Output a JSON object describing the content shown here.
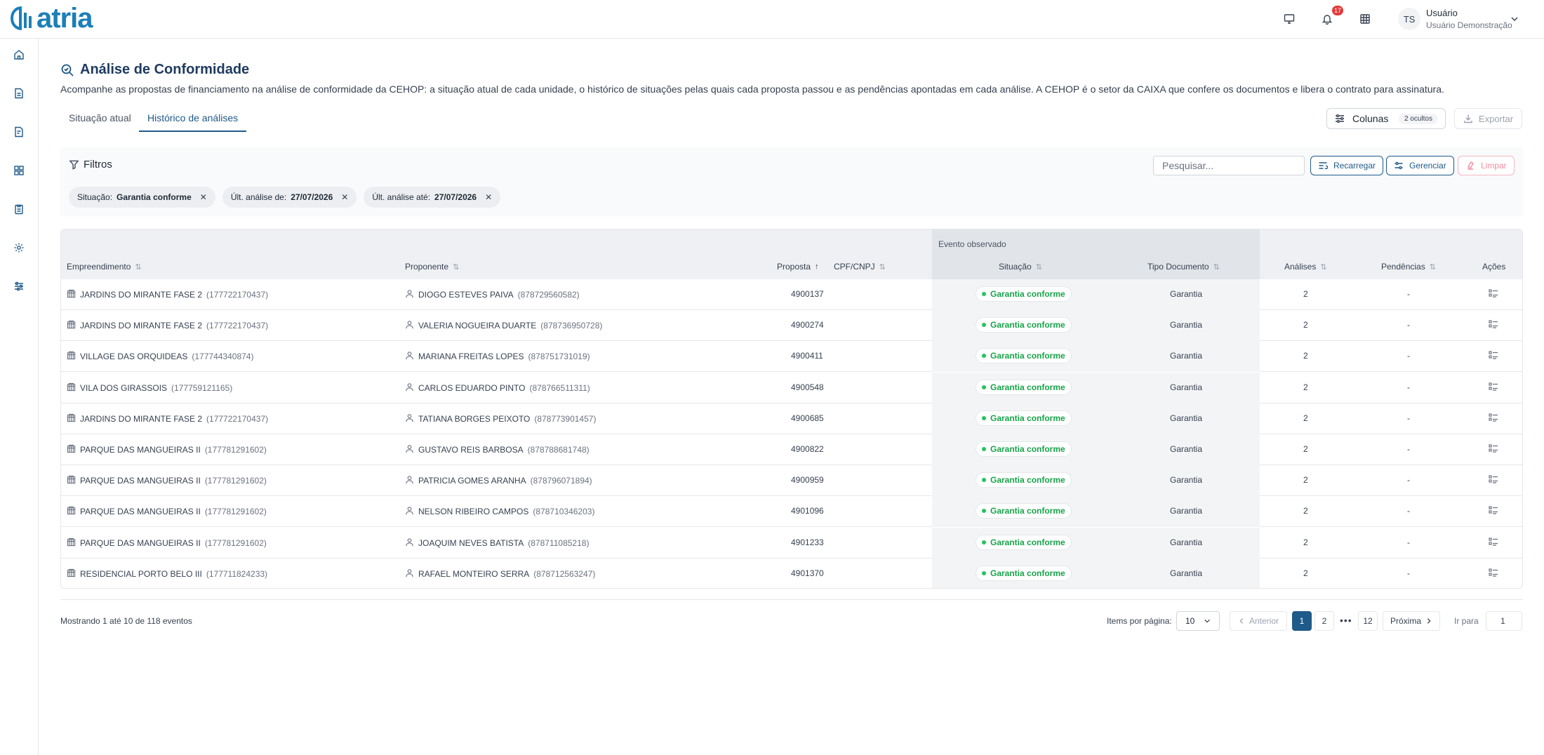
{
  "header": {
    "logo_text": "atria",
    "notification_count": "17",
    "user_initials": "TS",
    "user_name": "Usuário",
    "user_role": "Usuário Demonstração"
  },
  "page": {
    "title": "Análise de Conformidade",
    "description": "Acompanhe as propostas de financiamento na análise de conformidade da CEHOP: a situação atual de cada unidade, o histórico de situações pelas quais cada proposta passou e as pendências apontadas em cada análise. A CEHOP é o setor da CAIXA que confere os documentos e libera o contrato para assinatura."
  },
  "tabs": [
    {
      "label": "Situação atual",
      "active": false
    },
    {
      "label": "Histórico de análises",
      "active": true
    }
  ],
  "toolbar": {
    "columns_label": "Colunas",
    "hidden_count": "2 ocultos",
    "export_label": "Exportar"
  },
  "filters": {
    "title": "Filtros",
    "search_placeholder": "Pesquisar...",
    "reload_label": "Recarregar",
    "manage_label": "Gerenciar",
    "clear_label": "Limpar",
    "chips": [
      {
        "key": "Situação:",
        "value": "Garantia conforme"
      },
      {
        "key": "Últ. análise de:",
        "value": "27/07/2026"
      },
      {
        "key": "Últ. análise até:",
        "value": "27/07/2026"
      }
    ]
  },
  "table": {
    "group_label": "Evento observado",
    "columns": {
      "empreendimento": "Empreendimento",
      "proponente": "Proponente",
      "proposta": "Proposta",
      "cpf": "CPF/CNPJ",
      "situacao": "Situação",
      "tipo_documento": "Tipo Documento",
      "analises": "Análises",
      "pendencias": "Pendências",
      "acoes": "Ações"
    },
    "rows": [
      {
        "empreendimento": "JARDINS DO MIRANTE FASE 2",
        "emp_code": "(177722170437)",
        "proponente": "DIOGO ESTEVES PAIVA",
        "prop_code": "(878729560582)",
        "proposta": "4900137",
        "situacao": "Garantia conforme",
        "tipo": "Garantia",
        "analises": "2",
        "pendencias": "-"
      },
      {
        "empreendimento": "JARDINS DO MIRANTE FASE 2",
        "emp_code": "(177722170437)",
        "proponente": "VALERIA NOGUEIRA DUARTE",
        "prop_code": "(878736950728)",
        "proposta": "4900274",
        "situacao": "Garantia conforme",
        "tipo": "Garantia",
        "analises": "2",
        "pendencias": "-"
      },
      {
        "empreendimento": "VILLAGE DAS ORQUIDEAS",
        "emp_code": "(177744340874)",
        "proponente": "MARIANA FREITAS LOPES",
        "prop_code": "(878751731019)",
        "proposta": "4900411",
        "situacao": "Garantia conforme",
        "tipo": "Garantia",
        "analises": "2",
        "pendencias": "-"
      },
      {
        "empreendimento": "VILA DOS GIRASSOIS",
        "emp_code": "(177759121165)",
        "proponente": "CARLOS EDUARDO PINTO",
        "prop_code": "(878766511311)",
        "proposta": "4900548",
        "situacao": "Garantia conforme",
        "tipo": "Garantia",
        "analises": "2",
        "pendencias": "-"
      },
      {
        "empreendimento": "JARDINS DO MIRANTE FASE 2",
        "emp_code": "(177722170437)",
        "proponente": "TATIANA BORGES PEIXOTO",
        "prop_code": "(878773901457)",
        "proposta": "4900685",
        "situacao": "Garantia conforme",
        "tipo": "Garantia",
        "analises": "2",
        "pendencias": "-"
      },
      {
        "empreendimento": "PARQUE DAS MANGUEIRAS II",
        "emp_code": "(177781291602)",
        "proponente": "GUSTAVO REIS BARBOSA",
        "prop_code": "(878788681748)",
        "proposta": "4900822",
        "situacao": "Garantia conforme",
        "tipo": "Garantia",
        "analises": "2",
        "pendencias": "-"
      },
      {
        "empreendimento": "PARQUE DAS MANGUEIRAS II",
        "emp_code": "(177781291602)",
        "proponente": "PATRICIA GOMES ARANHA",
        "prop_code": "(878796071894)",
        "proposta": "4900959",
        "situacao": "Garantia conforme",
        "tipo": "Garantia",
        "analises": "2",
        "pendencias": "-"
      },
      {
        "empreendimento": "PARQUE DAS MANGUEIRAS II",
        "emp_code": "(177781291602)",
        "proponente": "NELSON RIBEIRO CAMPOS",
        "prop_code": "(878710346203)",
        "proposta": "4901096",
        "situacao": "Garantia conforme",
        "tipo": "Garantia",
        "analises": "2",
        "pendencias": "-"
      },
      {
        "empreendimento": "PARQUE DAS MANGUEIRAS II",
        "emp_code": "(177781291602)",
        "proponente": "JOAQUIM NEVES BATISTA",
        "prop_code": "(878711085218)",
        "proposta": "4901233",
        "situacao": "Garantia conforme",
        "tipo": "Garantia",
        "analises": "2",
        "pendencias": "-"
      },
      {
        "empreendimento": "RESIDENCIAL PORTO BELO III",
        "emp_code": "(177711824233)",
        "proponente": "RAFAEL MONTEIRO SERRA",
        "prop_code": "(878712563247)",
        "proposta": "4901370",
        "situacao": "Garantia conforme",
        "tipo": "Garantia",
        "analises": "2",
        "pendencias": "-"
      }
    ]
  },
  "pagination": {
    "showing": "Mostrando 1 até 10 de 118 eventos",
    "per_page_label": "Items por página:",
    "per_page_value": "10",
    "prev_label": "Anterior",
    "next_label": "Próxima",
    "pages": [
      "1",
      "2",
      "12"
    ],
    "current_page": "1",
    "ellipsis": "•••",
    "goto_label": "Ir para",
    "goto_value": "1"
  },
  "colors": {
    "brand": "#1c7fb8",
    "primary": "#1e5a8a",
    "success": "#18a34a",
    "danger": "#e23b3b"
  }
}
